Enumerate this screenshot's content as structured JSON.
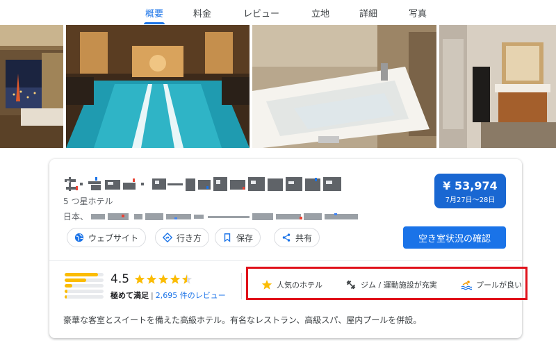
{
  "tabs": [
    {
      "label": "概要",
      "active": true
    },
    {
      "label": "料金",
      "active": false
    },
    {
      "label": "レビュー",
      "active": false
    },
    {
      "label": "立地",
      "active": false
    },
    {
      "label": "詳細",
      "active": false
    },
    {
      "label": "写真",
      "active": false
    }
  ],
  "photos": [
    "room-city-view",
    "indoor-pool",
    "bathtub",
    "bathroom-vanity"
  ],
  "hotel": {
    "star_class": "5 つ星ホテル",
    "address_prefix": "日本、"
  },
  "price": {
    "amount": "¥ 53,974",
    "dates": "7月27日～28日"
  },
  "actions": {
    "website": "ウェブサイト",
    "directions": "行き方",
    "save": "保存",
    "share": "共有"
  },
  "cta": "空き室状況の確認",
  "rating": {
    "score": "4.5",
    "stars_value": 4.5,
    "label": "極めて満足",
    "separator": "|",
    "reviews_link": "2,695 件のレビュー",
    "distribution": [
      0.85,
      0.55,
      0.2,
      0.08,
      0.05
    ]
  },
  "amenities": [
    {
      "label": "人気のホテル",
      "icon": "star-icon"
    },
    {
      "label": "ジム / 運動施設が充実",
      "icon": "dumbbell-icon"
    },
    {
      "label": "プールが良い",
      "icon": "pool-icon"
    }
  ],
  "description": "豪華な客室とスイートを備えた高級ホテル。有名なレストラン、高級スパ、屋内プールを併設。",
  "colors": {
    "accent": "#1a73e8",
    "price_bg": "#1967d2",
    "star": "#fbbc04",
    "highlight_frame": "#e0121b"
  }
}
